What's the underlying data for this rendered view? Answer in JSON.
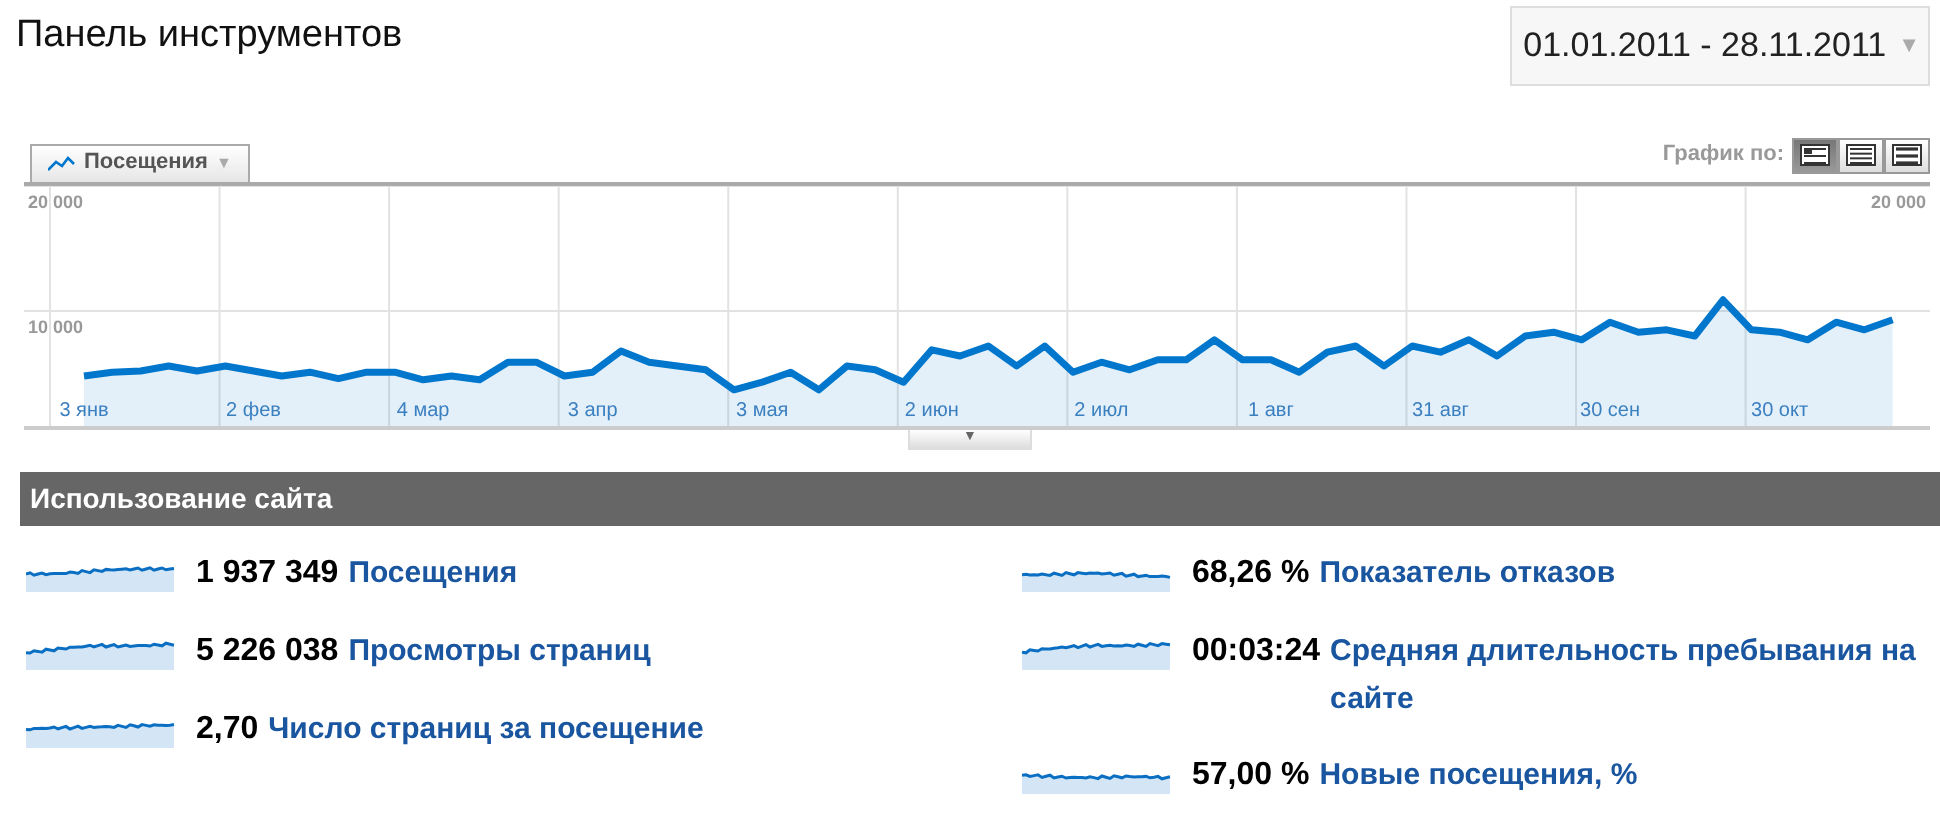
{
  "header": {
    "title": "Панель инструментов",
    "date_range": "01.01.2011 - 28.11.2011",
    "date_caret": "▼"
  },
  "graph": {
    "tab": {
      "caret": "▼"
    },
    "graph_by_label": "График по:",
    "period_buttons": [
      {
        "kind": "day",
        "selected": true
      },
      {
        "kind": "week",
        "selected": false
      },
      {
        "kind": "month",
        "selected": false
      }
    ],
    "right_axis_labels": [
      "20 000"
    ],
    "chart_data": {
      "type": "area",
      "categories": [
        "3 янв",
        null,
        null,
        null,
        null,
        null,
        "2 фев",
        null,
        null,
        null,
        null,
        null,
        "4 мар",
        null,
        null,
        null,
        null,
        null,
        "3 апр",
        null,
        null,
        null,
        null,
        null,
        "3 мая",
        null,
        null,
        null,
        null,
        null,
        "2 июн",
        null,
        null,
        null,
        null,
        null,
        "2 июл",
        null,
        null,
        null,
        null,
        null,
        "1 авг",
        null,
        null,
        null,
        null,
        null,
        "31 авг",
        null,
        null,
        null,
        null,
        null,
        "30 сен",
        null,
        null,
        null,
        null,
        null,
        "30 окт",
        null,
        null,
        null,
        null
      ],
      "series": [
        {
          "name": "Посещения",
          "color": "#0077cc",
          "values": [
            4800,
            5100,
            5200,
            5600,
            5200,
            5600,
            5200,
            4800,
            5100,
            4600,
            5100,
            5100,
            4500,
            4800,
            4500,
            5900,
            5900,
            4800,
            5100,
            6800,
            5900,
            5600,
            5300,
            3700,
            4300,
            5100,
            3700,
            5600,
            5300,
            4300,
            6900,
            6400,
            7200,
            5600,
            7200,
            5100,
            5900,
            5300,
            6100,
            6100,
            7700,
            6100,
            6100,
            5100,
            6700,
            7200,
            5600,
            7200,
            6700,
            7700,
            6400,
            8000,
            8300,
            7700,
            9100,
            8300,
            8500,
            8000,
            10900,
            8500,
            8300,
            7700,
            9100,
            8500,
            9300
          ]
        }
      ],
      "ylim": [
        0,
        20000
      ],
      "yticks": [
        {
          "value": 10000,
          "label": "10 000"
        },
        {
          "value": 20000,
          "label": "20 000"
        }
      ]
    },
    "collapse_caret": "▼"
  },
  "site_usage": {
    "title": "Использование сайта",
    "metrics": [
      {
        "value": "1 937 349",
        "label": "Посещения"
      },
      {
        "value": "68,26 %",
        "label": "Показатель отказов"
      },
      {
        "value": "5 226 038",
        "label": "Просмотры страниц"
      },
      {
        "value": "00:03:24",
        "label": "Средняя длительность пребывания на сайте"
      },
      {
        "value": "2,70",
        "label": "Число страниц за посещение"
      },
      {
        "value": "57,00 %",
        "label": "Новые посещения, %"
      }
    ]
  }
}
